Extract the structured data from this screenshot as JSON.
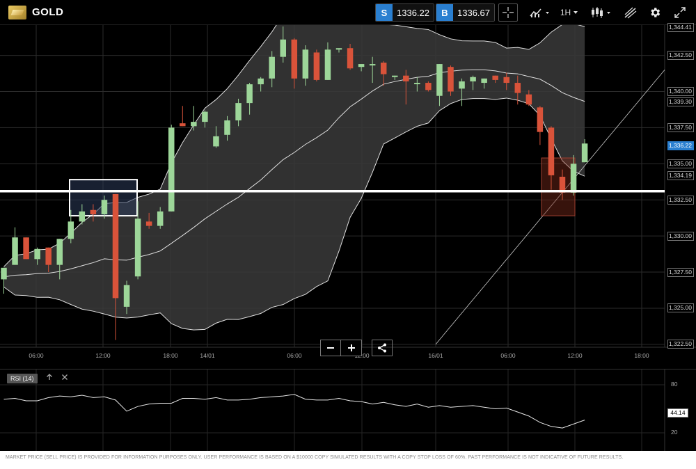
{
  "header": {
    "instrument": "GOLD",
    "sell": {
      "tag": "S",
      "price": "1336.22"
    },
    "buy": {
      "tag": "B",
      "price": "1336.67"
    },
    "timeframe": "1H"
  },
  "chart": {
    "price_labels": [
      "1,344.41",
      "1,342.50",
      "1,340.00",
      "1,339.30",
      "1,337.50",
      "1,336.22",
      "1,335.00",
      "1,334.19",
      "1,332.50",
      "1,330.00",
      "1,327.50",
      "1,325.00",
      "1,322.50"
    ],
    "current_price_label": "1,336.22",
    "time_labels": [
      "06:00",
      "12:00",
      "18:00",
      "14/01",
      "06:00",
      "12:00",
      "16/01",
      "06:00",
      "12:00",
      "18:00"
    ]
  },
  "chart_data": {
    "type": "candlestick",
    "ylim": [
      1322.3,
      1344.6
    ],
    "overlays": [
      "Bollinger Bands"
    ],
    "candles": [
      {
        "o": 1327.0,
        "h": 1327.8,
        "l": 1326.0,
        "c": 1327.8
      },
      {
        "o": 1328.0,
        "h": 1330.6,
        "l": 1328.0,
        "c": 1329.9
      },
      {
        "o": 1329.9,
        "h": 1329.9,
        "l": 1328.4,
        "c": 1328.4
      },
      {
        "o": 1328.4,
        "h": 1329.2,
        "l": 1328.0,
        "c": 1329.1
      },
      {
        "o": 1329.2,
        "h": 1329.2,
        "l": 1327.5,
        "c": 1328.0
      },
      {
        "o": 1328.0,
        "h": 1329.8,
        "l": 1327.0,
        "c": 1329.8
      },
      {
        "o": 1329.8,
        "h": 1331.8,
        "l": 1329.5,
        "c": 1331.0
      },
      {
        "o": 1331.0,
        "h": 1332.2,
        "l": 1330.8,
        "c": 1331.7
      },
      {
        "o": 1331.8,
        "h": 1332.2,
        "l": 1331.0,
        "c": 1331.5
      },
      {
        "o": 1331.5,
        "h": 1332.8,
        "l": 1331.2,
        "c": 1332.5
      },
      {
        "o": 1332.9,
        "h": 1332.9,
        "l": 1322.8,
        "c": 1325.7
      },
      {
        "o": 1325.1,
        "h": 1326.9,
        "l": 1324.6,
        "c": 1326.6
      },
      {
        "o": 1327.2,
        "h": 1332.4,
        "l": 1327.0,
        "c": 1331.2
      },
      {
        "o": 1331.0,
        "h": 1331.6,
        "l": 1330.5,
        "c": 1330.7
      },
      {
        "o": 1330.7,
        "h": 1332.0,
        "l": 1330.5,
        "c": 1331.7
      },
      {
        "o": 1331.7,
        "h": 1337.7,
        "l": 1331.7,
        "c": 1337.5
      },
      {
        "o": 1337.8,
        "h": 1339.0,
        "l": 1337.6,
        "c": 1337.6
      },
      {
        "o": 1337.6,
        "h": 1339.0,
        "l": 1337.3,
        "c": 1337.9
      },
      {
        "o": 1337.9,
        "h": 1338.7,
        "l": 1337.5,
        "c": 1338.6
      },
      {
        "o": 1336.2,
        "h": 1337.6,
        "l": 1336.1,
        "c": 1336.9
      },
      {
        "o": 1337.0,
        "h": 1338.3,
        "l": 1336.6,
        "c": 1338.0
      },
      {
        "o": 1338.0,
        "h": 1339.5,
        "l": 1337.6,
        "c": 1339.2
      },
      {
        "o": 1339.2,
        "h": 1340.6,
        "l": 1338.4,
        "c": 1340.5
      },
      {
        "o": 1340.5,
        "h": 1341.0,
        "l": 1340.0,
        "c": 1340.9
      },
      {
        "o": 1340.9,
        "h": 1342.8,
        "l": 1340.3,
        "c": 1342.4
      },
      {
        "o": 1342.4,
        "h": 1344.5,
        "l": 1342.0,
        "c": 1343.6
      },
      {
        "o": 1343.6,
        "h": 1343.7,
        "l": 1340.2,
        "c": 1340.9
      },
      {
        "o": 1340.9,
        "h": 1343.2,
        "l": 1340.4,
        "c": 1342.9
      },
      {
        "o": 1342.7,
        "h": 1342.9,
        "l": 1340.7,
        "c": 1340.8
      },
      {
        "o": 1340.8,
        "h": 1343.4,
        "l": 1340.8,
        "c": 1342.9
      },
      {
        "o": 1342.9,
        "h": 1343.0,
        "l": 1342.7,
        "c": 1343.0
      },
      {
        "o": 1343.0,
        "h": 1343.3,
        "l": 1341.5,
        "c": 1341.6
      },
      {
        "o": 1341.7,
        "h": 1341.9,
        "l": 1341.4,
        "c": 1341.9
      },
      {
        "o": 1341.9,
        "h": 1342.4,
        "l": 1340.6,
        "c": 1341.9
      },
      {
        "o": 1342.0,
        "h": 1342.1,
        "l": 1340.4,
        "c": 1341.2
      },
      {
        "o": 1341.0,
        "h": 1341.1,
        "l": 1340.8,
        "c": 1341.1
      },
      {
        "o": 1341.1,
        "h": 1341.5,
        "l": 1339.1,
        "c": 1340.7
      },
      {
        "o": 1340.6,
        "h": 1341.0,
        "l": 1340.0,
        "c": 1340.6
      },
      {
        "o": 1340.6,
        "h": 1340.7,
        "l": 1340.0,
        "c": 1340.1
      },
      {
        "o": 1339.7,
        "h": 1341.9,
        "l": 1339.0,
        "c": 1341.9
      },
      {
        "o": 1341.7,
        "h": 1341.8,
        "l": 1339.7,
        "c": 1340.0
      },
      {
        "o": 1340.2,
        "h": 1340.9,
        "l": 1339.0,
        "c": 1340.7
      },
      {
        "o": 1340.7,
        "h": 1341.1,
        "l": 1340.1,
        "c": 1341.0
      },
      {
        "o": 1340.6,
        "h": 1340.9,
        "l": 1340.2,
        "c": 1340.9
      },
      {
        "o": 1341.1,
        "h": 1341.1,
        "l": 1340.6,
        "c": 1340.8
      },
      {
        "o": 1341.0,
        "h": 1341.3,
        "l": 1340.1,
        "c": 1340.6
      },
      {
        "o": 1340.6,
        "h": 1341.1,
        "l": 1339.1,
        "c": 1339.9
      },
      {
        "o": 1339.8,
        "h": 1340.1,
        "l": 1339.0,
        "c": 1339.1
      },
      {
        "o": 1338.9,
        "h": 1339.0,
        "l": 1336.3,
        "c": 1337.2
      },
      {
        "o": 1337.5,
        "h": 1337.6,
        "l": 1333.2,
        "c": 1334.2
      },
      {
        "o": 1334.1,
        "h": 1334.6,
        "l": 1332.5,
        "c": 1333.0
      },
      {
        "o": 1333.0,
        "h": 1335.6,
        "l": 1332.8,
        "c": 1335.0
      },
      {
        "o": 1335.1,
        "h": 1336.7,
        "l": 1335.1,
        "c": 1336.4
      }
    ],
    "rsi": {
      "name": "RSI (14)",
      "levels": [
        80,
        20
      ],
      "current": "44.14",
      "values": [
        62,
        63,
        60,
        60,
        64,
        66,
        65,
        67,
        64,
        65,
        61,
        47,
        53,
        56,
        57,
        57,
        63,
        63,
        62,
        64,
        61,
        61,
        62,
        64,
        65,
        66,
        68,
        62,
        61,
        61,
        63,
        60,
        59,
        56,
        58,
        55,
        53,
        56,
        52,
        54,
        52,
        53,
        54,
        52,
        50,
        51,
        46,
        41,
        33,
        28,
        26,
        31,
        36
      ]
    }
  },
  "drawings": {
    "horizontal_level": "1333.1",
    "highlight_box": {
      "from": "1331.4",
      "to": "1333.9"
    },
    "trend_line": "rising"
  },
  "rsi_panel": {
    "tag": "RSI (14)",
    "level_labels": [
      "80",
      "20"
    ],
    "current": "44.14"
  },
  "disclaimer": "MARKET PRICE (SELL PRICE) IS PROVIDED FOR INFORMATION PURPOSES ONLY. USER PERFORMANCE IS BASED ON A $10000 COPY SIMULATED RESULTS WITH A COPY STOP LOSS OF 60%. PAST PERFORMANCE IS NOT INDICATIVE OF FUTURE RESULTS.",
  "colors": {
    "up": "#9dd699",
    "down": "#d9533a",
    "accent": "#2a7fd0",
    "band": "#3a3a3a"
  }
}
